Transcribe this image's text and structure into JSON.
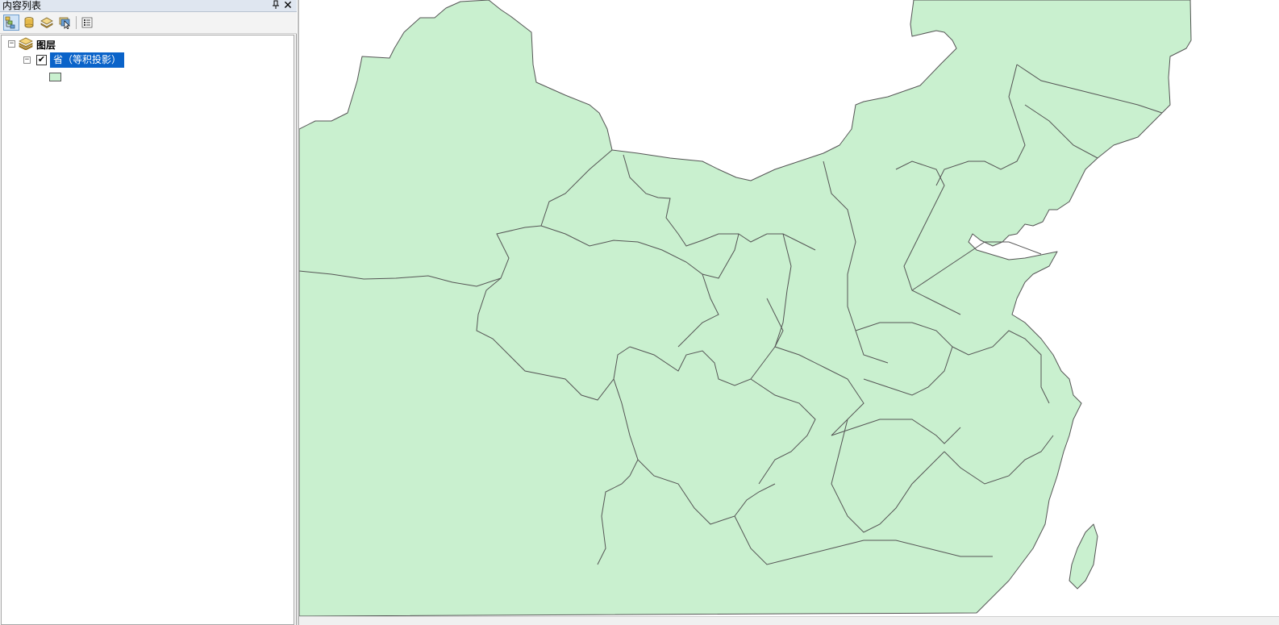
{
  "toc": {
    "title": "内容列表",
    "pin_glyph": "ᵽ",
    "close_glyph": "✕",
    "toolbar": {
      "buttons": [
        {
          "name": "list-by-drawing-order",
          "icon": "drawing-order-icon",
          "active": true
        },
        {
          "name": "list-by-source",
          "icon": "database-icon",
          "active": false
        },
        {
          "name": "list-by-visibility",
          "icon": "visibility-layers-icon",
          "active": false
        },
        {
          "name": "list-by-selection",
          "icon": "selection-icon",
          "active": false
        },
        {
          "name": "options",
          "icon": "options-icon",
          "active": false
        }
      ]
    },
    "tree": {
      "root_label": "图层",
      "root_expander": "−",
      "layer": {
        "name": "省（等积投影）",
        "checked": true,
        "check_glyph": "✔",
        "expander": "−",
        "symbol_fill": "#c9f0cf"
      }
    }
  },
  "map": {
    "land_fill": "#c9f0cf",
    "border_color": "#555555",
    "sea_color": "#ffffff"
  }
}
